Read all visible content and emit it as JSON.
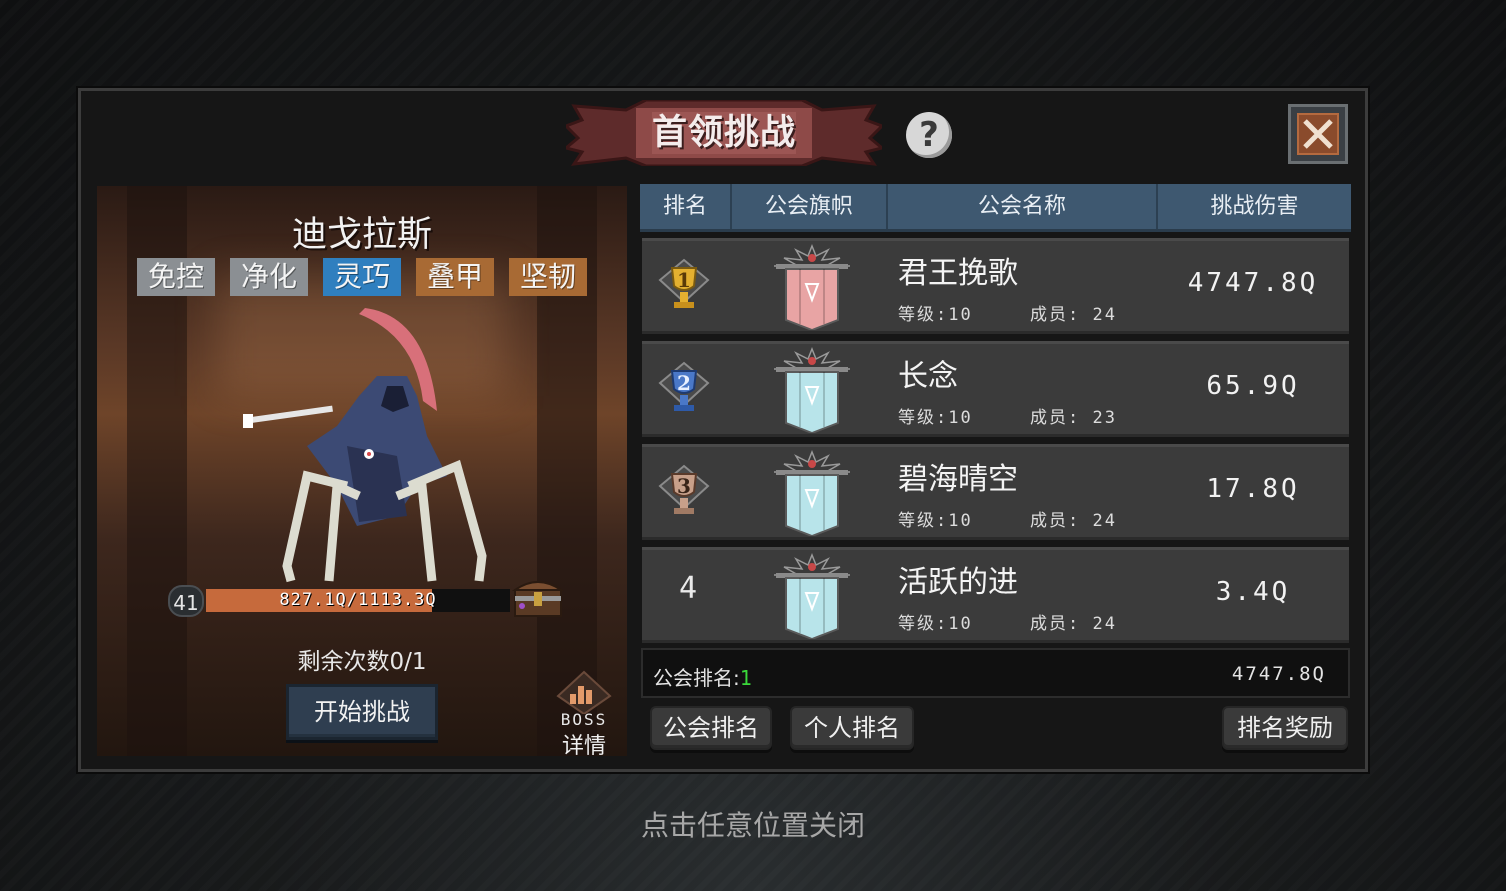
{
  "title": "首领挑战",
  "help_glyph": "?",
  "boss": {
    "name": "迪戈拉斯",
    "tags": [
      {
        "label": "免控",
        "color": "#8b8f93"
      },
      {
        "label": "净化",
        "color": "#8b8f93"
      },
      {
        "label": "灵巧",
        "color": "#2f7fbf"
      },
      {
        "label": "叠甲",
        "color": "#a86a34"
      },
      {
        "label": "坚韧",
        "color": "#a86a34"
      }
    ],
    "level": "41",
    "hp_text": "827.1Q/1113.3Q",
    "hp_fraction": 0.743,
    "remaining_text": "剩余次数0/1",
    "start_label": "开始挑战",
    "detail_line1": "BOSS",
    "detail_line2": "详情"
  },
  "table": {
    "headers": [
      "排名",
      "公会旗帜",
      "公会名称",
      "挑战伤害"
    ],
    "rows": [
      {
        "rank": "1",
        "trophy": "gold-trophy",
        "name": "君王挽歌",
        "level": "等级:10",
        "members": "成员: 24",
        "damage": "4747.8Q",
        "flag": "#e8a4a4"
      },
      {
        "rank": "2",
        "trophy": "blue-trophy",
        "name": "长念",
        "level": "等级:10",
        "members": "成员: 23",
        "damage": "65.9Q",
        "flag": "#b8e4ea"
      },
      {
        "rank": "3",
        "trophy": "bronze-trophy",
        "name": "碧海晴空",
        "level": "等级:10",
        "members": "成员: 24",
        "damage": "17.8Q",
        "flag": "#b8e4ea"
      },
      {
        "rank": "4",
        "trophy": "",
        "name": "活跃的进",
        "level": "等级:10",
        "members": "成员: 24",
        "damage": "3.4Q",
        "flag": "#b8e4ea"
      }
    ]
  },
  "summary": {
    "label": "公会排名:",
    "rank": "1",
    "damage": "4747.8Q"
  },
  "buttons": {
    "guild_rank": "公会排名",
    "personal_rank": "个人排名",
    "rank_reward": "排名奖励"
  },
  "hint": "点击任意位置关闭"
}
